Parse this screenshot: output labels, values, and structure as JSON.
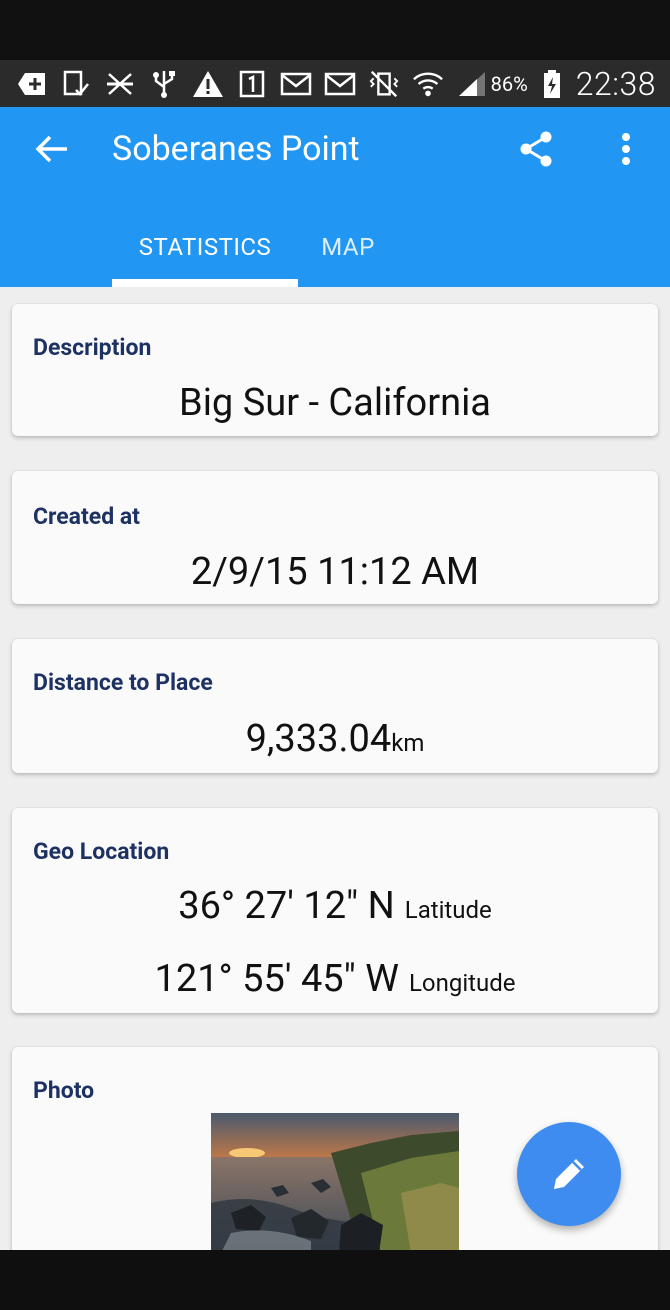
{
  "status_bar": {
    "icons": [
      "add-box-icon",
      "tablet-check-icon",
      "airplane-crossed-icon",
      "usb-icon",
      "warning-icon",
      "sim-1-icon",
      "mail-icon",
      "mail-icon",
      "vibrate-off-icon",
      "wifi-icon",
      "signal-icon",
      "battery-icon"
    ],
    "battery_percent": "86%",
    "time": "22:38"
  },
  "app_bar": {
    "title": "Soberanes Point",
    "back_icon": "arrow-back-icon",
    "share_icon": "share-icon",
    "more_icon": "more-vert-icon",
    "color": "#2196f3"
  },
  "tabs": [
    {
      "label": "STATISTICS",
      "selected": true
    },
    {
      "label": "MAP",
      "selected": false
    }
  ],
  "cards": {
    "description": {
      "label": "Description",
      "value": "Big Sur - California"
    },
    "created_at": {
      "label": "Created at",
      "value": "2/9/15 11:12 AM"
    },
    "distance": {
      "label": "Distance to Place",
      "value": "9,333.04",
      "unit": "km"
    },
    "geo": {
      "label": "Geo Location",
      "latitude": "36° 27' 12\" N",
      "latitude_caption": "Latitude",
      "longitude": "121° 55' 45\" W",
      "longitude_caption": "Longitude"
    },
    "photo": {
      "label": "Photo"
    }
  },
  "fab": {
    "icon": "edit-pencil-icon",
    "color": "#3f8cf0"
  }
}
